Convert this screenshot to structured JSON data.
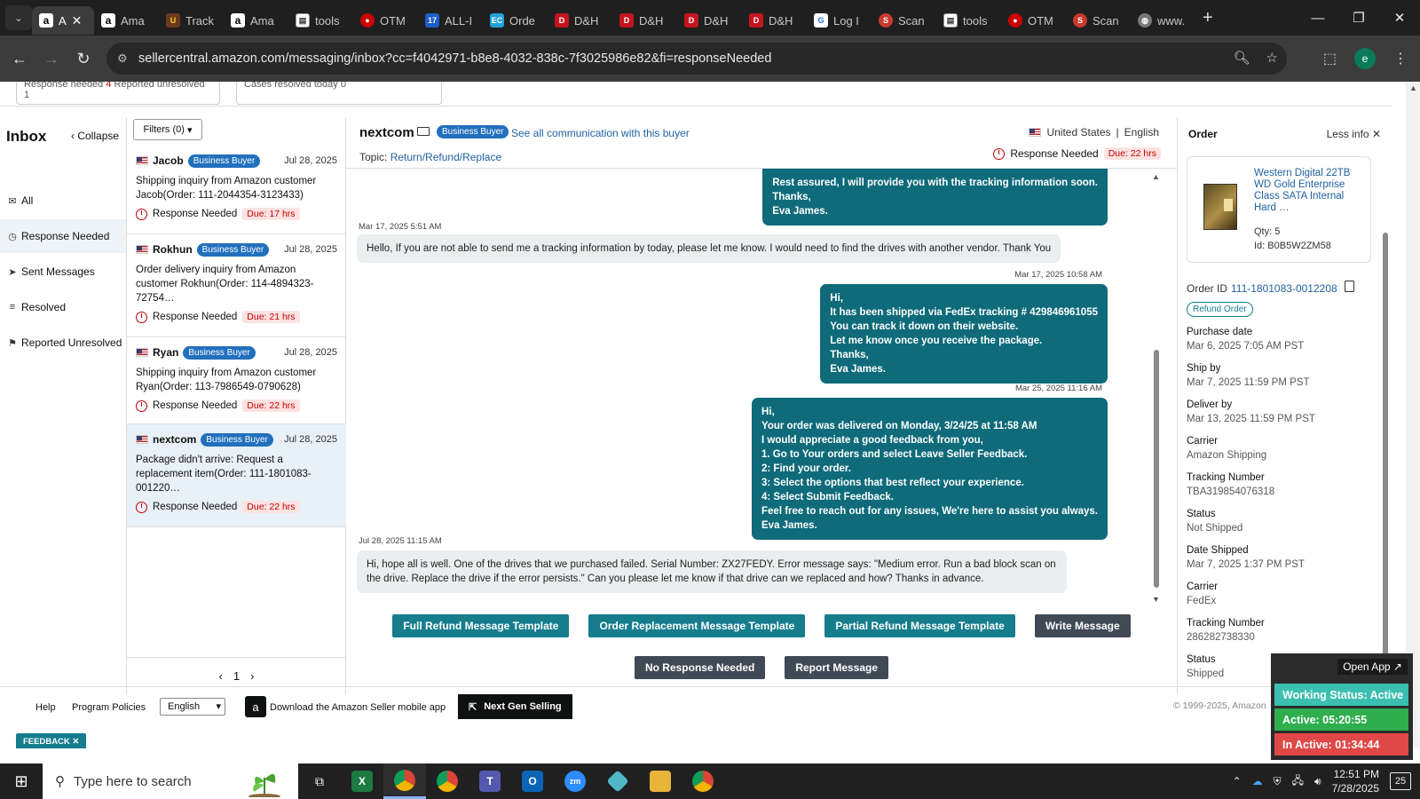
{
  "browser": {
    "tabs": [
      {
        "label": "A",
        "icon": "amazon-icon",
        "active": true
      },
      {
        "label": "Ama",
        "icon": "amazon-icon"
      },
      {
        "label": "Track",
        "icon": "ups-icon"
      },
      {
        "label": "Ama",
        "icon": "amazon-icon"
      },
      {
        "label": "tools",
        "icon": "tools-icon"
      },
      {
        "label": "OTM",
        "icon": "otm-icon"
      },
      {
        "label": "ALL-I",
        "icon": "seventeen-track-icon"
      },
      {
        "label": "Orde",
        "icon": "ec-icon"
      },
      {
        "label": "D&H",
        "icon": "dh-icon"
      },
      {
        "label": "D&H",
        "icon": "dh-icon"
      },
      {
        "label": "D&H",
        "icon": "dh-icon"
      },
      {
        "label": "D&H",
        "icon": "dh-icon"
      },
      {
        "label": "Log I",
        "icon": "login-icon"
      },
      {
        "label": "Scan",
        "icon": "scan-icon"
      },
      {
        "label": "tools",
        "icon": "tools-icon"
      },
      {
        "label": "OTM",
        "icon": "otm-icon"
      },
      {
        "label": "Scan",
        "icon": "scan-icon"
      },
      {
        "label": "www.",
        "icon": "globe-icon"
      }
    ],
    "url": "sellercentral.amazon.com/messaging/inbox?cc=f4042971-b8e8-4032-838c-7f3025986e82&fi=responseNeeded",
    "profile_initial": "e"
  },
  "stats": {
    "response_needed_label": "Response needed",
    "response_needed_count": "4",
    "reported_unresolved": "Reported unresolved 1",
    "cases_resolved": "Cases resolved today 0"
  },
  "leftnav": {
    "title": "Inbox",
    "collapse": "Collapse",
    "items": [
      {
        "label": "All",
        "icon": "mail-icon"
      },
      {
        "label": "Response Needed",
        "icon": "clock-icon"
      },
      {
        "label": "Sent Messages",
        "icon": "send-icon"
      },
      {
        "label": "Resolved",
        "icon": "resolved-icon"
      },
      {
        "label": "Reported Unresolved",
        "icon": "user-flag-icon"
      }
    ]
  },
  "convlist": {
    "filters": "Filters (0)",
    "items": [
      {
        "name": "Jacob",
        "badge": "Business Buyer",
        "date": "Jul 28, 2025",
        "text": "Shipping inquiry from Amazon customer Jacob(Order: 111-2044354-3123433)",
        "status": "Response Needed",
        "due": "Due: 17 hrs"
      },
      {
        "name": "Rokhun",
        "badge": "Business Buyer",
        "date": "Jul 28, 2025",
        "text": "Order delivery inquiry from Amazon customer Rokhun(Order: 114-4894323-72754…",
        "status": "Response Needed",
        "due": "Due: 21 hrs"
      },
      {
        "name": "Ryan",
        "badge": "Business Buyer",
        "date": "Jul 28, 2025",
        "text": "Shipping inquiry from Amazon customer Ryan(Order: 113-7986549-0790628)",
        "status": "Response Needed",
        "due": "Due: 22 hrs"
      },
      {
        "name": "nextcom",
        "badge": "Business Buyer",
        "date": "Jul 28, 2025",
        "text": "Package didn't arrive: Request a replacement item(Order: 111-1801083-001220…",
        "status": "Response Needed",
        "due": "Due: 22 hrs"
      }
    ],
    "page": "1"
  },
  "thread": {
    "buyer": "nextcom",
    "badge": "Business Buyer",
    "see_all": "See all communication with this buyer",
    "country": "United States",
    "language": "English",
    "topic_label": "Topic:",
    "topic": "Return/Refund/Replace",
    "status": "Response Needed",
    "due": "Due: 22 hrs",
    "messages": [
      {
        "dir": "out",
        "stamp": "",
        "lines": [
          "Rest assured, I will provide you with the tracking information soon.",
          "Thanks,",
          "Eva James."
        ]
      },
      {
        "dir": "in",
        "stamp": "Mar 17, 2025 5:51 AM",
        "lines": [
          "Hello, If you are not able to send me a tracking information by today, please let me know. I would need to find the drives with another vendor. Thank You"
        ]
      },
      {
        "dir": "out",
        "stamp": "Mar 17, 2025 10:58 AM",
        "lines": [
          "Hi,",
          "It has been shipped via FedEx tracking # 429846961055",
          "You can track it down on their website.",
          "Let me know once you receive the package.",
          "Thanks,",
          "Eva James."
        ]
      },
      {
        "dir": "out",
        "stamp": "Mar 25, 2025 11:16 AM",
        "lines": [
          "Hi,",
          "Your order was delivered on Monday, 3/24/25 at 11:58 AM",
          "I would appreciate a good feedback from you,",
          "1. Go to Your orders and select Leave Seller Feedback.",
          "2: Find your order.",
          "3: Select the options that best reflect your experience.",
          "4: Select Submit Feedback.",
          "Feel free to reach out for any issues, We're here to assist you always.",
          "Eva James."
        ]
      },
      {
        "dir": "in",
        "stamp": "Jul 28, 2025 11:15 AM",
        "lines": [
          "Hi, hope all is well. One of the drives that we purchased failed. Serial Number: ZX27FEDY. Error message says: \"Medium error. Run a bad block scan on the drive. Replace the drive if the error persists.\" Can you please let me know if that drive can we replaced and how? Thanks in advance."
        ]
      }
    ],
    "buttons": {
      "full_refund": "Full Refund Message Template",
      "replacement": "Order Replacement Message Template",
      "partial_refund": "Partial Refund Message Template",
      "write": "Write Message",
      "no_response": "No Response Needed",
      "report": "Report Message"
    }
  },
  "order": {
    "title": "Order",
    "less_info": "Less info",
    "product_title": "Western Digital 22TB WD Gold Enterprise Class SATA Internal Hard …",
    "qty": "Qty: 5",
    "product_id": "Id: B0B5W2ZM58",
    "order_id_label": "Order ID",
    "order_id": "111-1801083-0012208",
    "refund_button": "Refund Order",
    "fields": [
      {
        "k": "Purchase date",
        "v": "Mar 6, 2025 7:05 AM PST"
      },
      {
        "k": "Ship by",
        "v": "Mar 7, 2025 11:59 PM PST"
      },
      {
        "k": "Deliver by",
        "v": "Mar 13, 2025 11:59 PM PST"
      },
      {
        "k": "Carrier",
        "v": "Amazon Shipping"
      },
      {
        "k": "Tracking Number",
        "v": "TBA319854076318"
      },
      {
        "k": "Status",
        "v": "Not Shipped"
      },
      {
        "k": "Date Shipped",
        "v": "Mar 7, 2025 1:37 PM PST"
      },
      {
        "k": "Carrier",
        "v": "FedEx"
      },
      {
        "k": "Tracking Number",
        "v": "286282738330"
      },
      {
        "k": "Status",
        "v": "Shipped"
      }
    ]
  },
  "footer": {
    "help": "Help",
    "policies": "Program Policies",
    "language": "English",
    "download": "Download the Amazon Seller mobile app",
    "next_gen": "Next Gen Selling",
    "copyright": "© 1999-2025, Amazon",
    "feedback": "FEEDBACK ✕"
  },
  "widget": {
    "open_app": "Open App ↗",
    "working": "Working Status: Active",
    "active": "Active: 05:20:55",
    "inactive": "In Active: 01:34:44",
    "colors": {
      "working": "#3bbfb0",
      "active": "#2fae4e",
      "inactive": "#e04848"
    }
  },
  "taskbar": {
    "search_placeholder": "Type here to search",
    "time": "12:51 PM",
    "date": "7/28/2025",
    "notifications": "25"
  },
  "colors": {
    "teal_button": "#157d8c",
    "dark_button": "#3f4a55",
    "badge": "#2270bd",
    "link": "#2162a1",
    "outgoing_bubble": "#0f6b7a"
  }
}
